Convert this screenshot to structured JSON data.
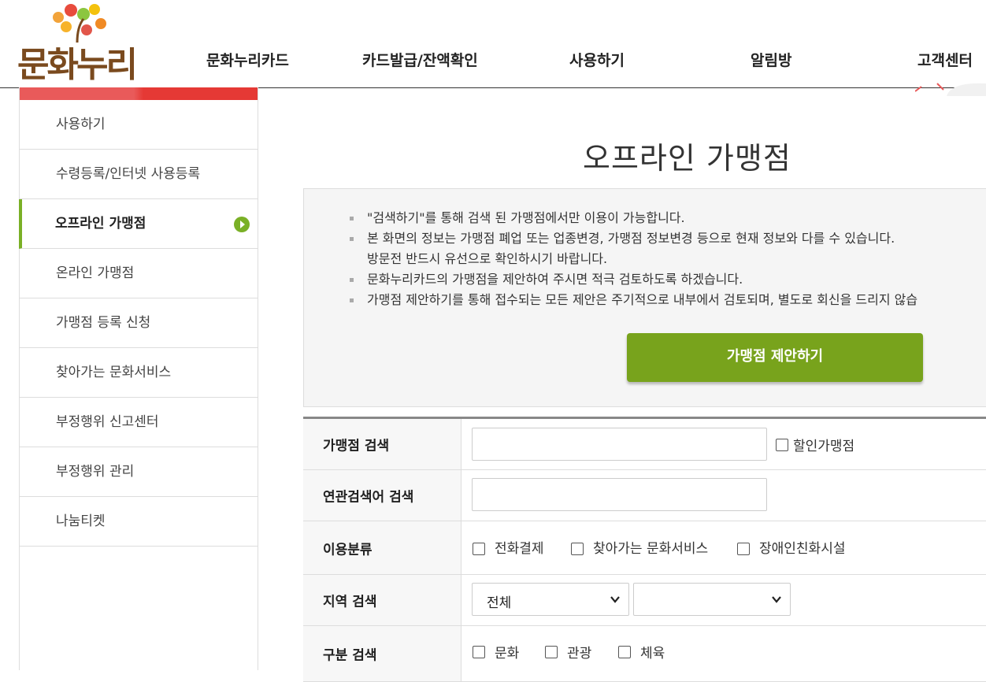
{
  "header": {
    "logo_text": "문화누리",
    "nav": [
      "문화누리카드",
      "카드발급/잔액확인",
      "사용하기",
      "알림방",
      "고객센터"
    ]
  },
  "sidebar": {
    "items": [
      {
        "label": "사용하기"
      },
      {
        "label": "수령등록/인터넷 사용등록"
      },
      {
        "label": "오프라인 가맹점",
        "active": true
      },
      {
        "label": "온라인 가맹점"
      },
      {
        "label": "가맹점 등록 신청"
      },
      {
        "label": "찾아가는 문화서비스"
      },
      {
        "label": "부정행위 신고센터"
      },
      {
        "label": "부정행위 관리"
      },
      {
        "label": "나눔티켓"
      }
    ]
  },
  "main": {
    "title": "오프라인 가맹점",
    "notices": [
      "\"검색하기\"를 통해 검색 된 가맹점에서만 이용이 가능합니다.",
      "본 화면의 정보는 가맹점 폐업 또는 업종변경, 가맹점 정보변경 등으로 현재 정보와 다를 수 있습니다.",
      "방문전 반드시 유선으로 확인하시기 바랍니다.",
      "문화누리카드의 가맹점을 제안하여 주시면 적극 검토하도록 하겠습니다.",
      "가맹점 제안하기를 통해 접수되는 모든 제안은 주기적으로 내부에서 검토되며, 별도로 회신을 드리지 않습"
    ],
    "propose_button": "가맹점 제안하기"
  },
  "search": {
    "store_search": {
      "label": "가맹점 검색",
      "value": "",
      "checkbox_label": "할인가맹점"
    },
    "keyword_search": {
      "label": "연관검색어 검색",
      "value": ""
    },
    "usage_type": {
      "label": "이용분류",
      "options": [
        "전화결제",
        "찾아가는 문화서비스",
        "장애인친화시설"
      ]
    },
    "region": {
      "label": "지역 검색",
      "select1_value": "전체",
      "select2_value": ""
    },
    "category": {
      "label": "구분 검색",
      "options": [
        "문화",
        "관광",
        "체육"
      ]
    }
  },
  "colors": {
    "accent_green": "#78a31c",
    "sidebar_top_red": "#e53935",
    "logo_brown": "#7a4a1e"
  }
}
